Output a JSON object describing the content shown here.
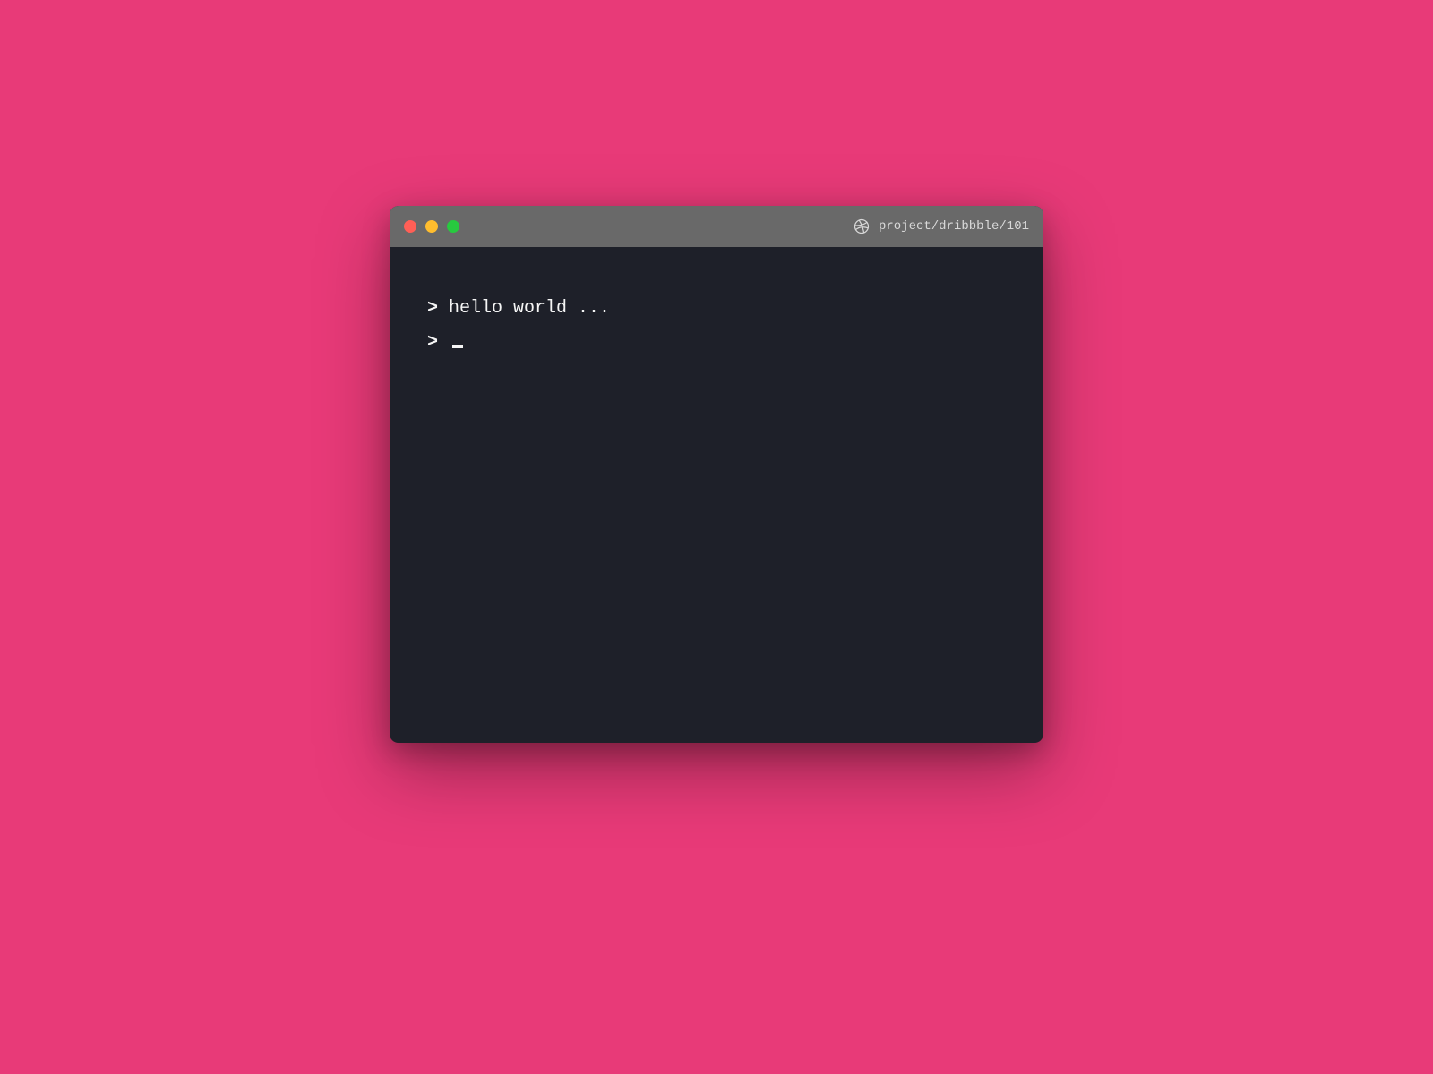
{
  "titlebar": {
    "path": "project/dribbble/101"
  },
  "terminal": {
    "prompt": ">",
    "line1": "hello world ..."
  }
}
